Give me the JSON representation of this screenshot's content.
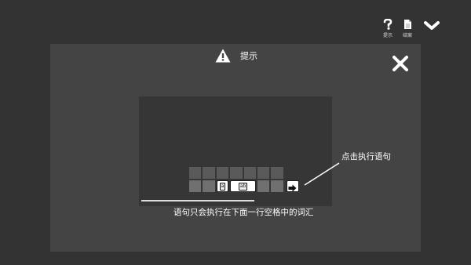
{
  "toolbar": {
    "help_label": "提示",
    "log_label": "结案",
    "help_icon": "question-icon",
    "log_icon": "document-icon",
    "collapse_icon": "chevron-down-icon"
  },
  "modal": {
    "title": "提示",
    "title_icon": "warning-icon",
    "close_icon": "close-icon"
  },
  "preview": {
    "top_row_cells": 7,
    "bottom_row": [
      "",
      "",
      "",
      "a",
      "ab",
      "",
      ""
    ],
    "chip_small": "a",
    "chip_wide": "ab",
    "run_icon": "arrow-right-icon"
  },
  "hints": {
    "run_hint": "点击执行语句",
    "row_hint": "语句只会执行在下面一行空格中的词汇"
  },
  "colors": {
    "background": "#333333",
    "modal": "#444444",
    "preview": "#363636"
  }
}
